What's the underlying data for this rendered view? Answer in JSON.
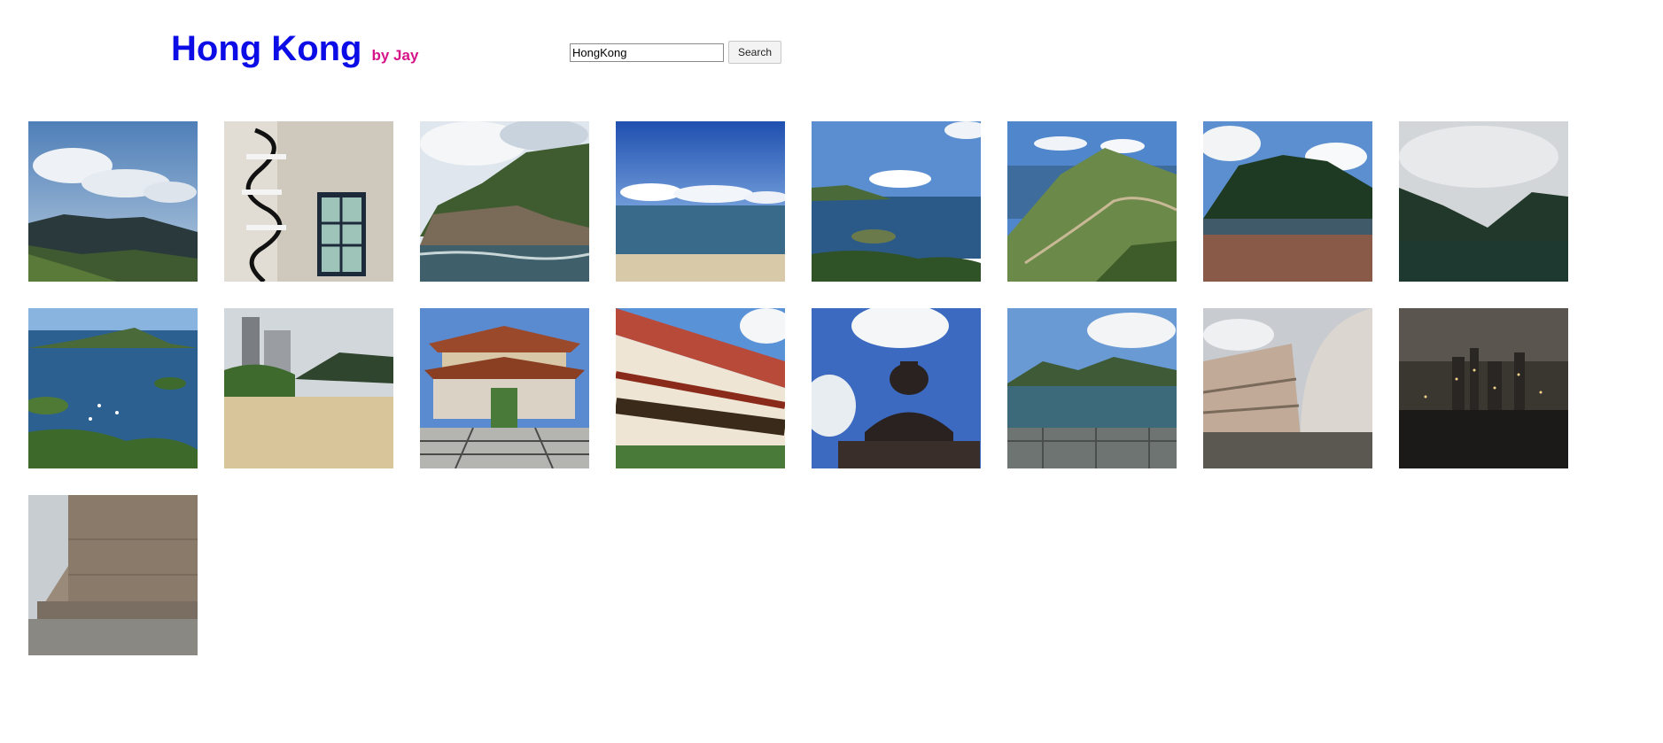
{
  "header": {
    "title": "Hong Kong",
    "byline": "by Jay"
  },
  "search": {
    "value": "HongKong",
    "button_label": "Search"
  },
  "gallery": {
    "photos": [
      {
        "icon": "mountain-bay-clouds-photo"
      },
      {
        "icon": "spiral-staircase-window-photo"
      },
      {
        "icon": "rocky-island-sea-photo"
      },
      {
        "icon": "beach-blue-sky-photo"
      },
      {
        "icon": "coastal-islands-view-photo"
      },
      {
        "icon": "green-hillside-sea-photo"
      },
      {
        "icon": "mountain-pebble-shore-photo"
      },
      {
        "icon": "reservoir-cloudy-hills-photo"
      },
      {
        "icon": "bay-boats-aerial-photo"
      },
      {
        "icon": "sandy-beach-towers-photo"
      },
      {
        "icon": "temple-courtyard-photo"
      },
      {
        "icon": "monastery-building-photo"
      },
      {
        "icon": "big-buddha-statue-photo"
      },
      {
        "icon": "reservoir-dam-hills-photo"
      },
      {
        "icon": "space-museum-dome-photo"
      },
      {
        "icon": "city-night-skyline-photo"
      },
      {
        "icon": "cultural-centre-plaza-photo"
      }
    ]
  }
}
